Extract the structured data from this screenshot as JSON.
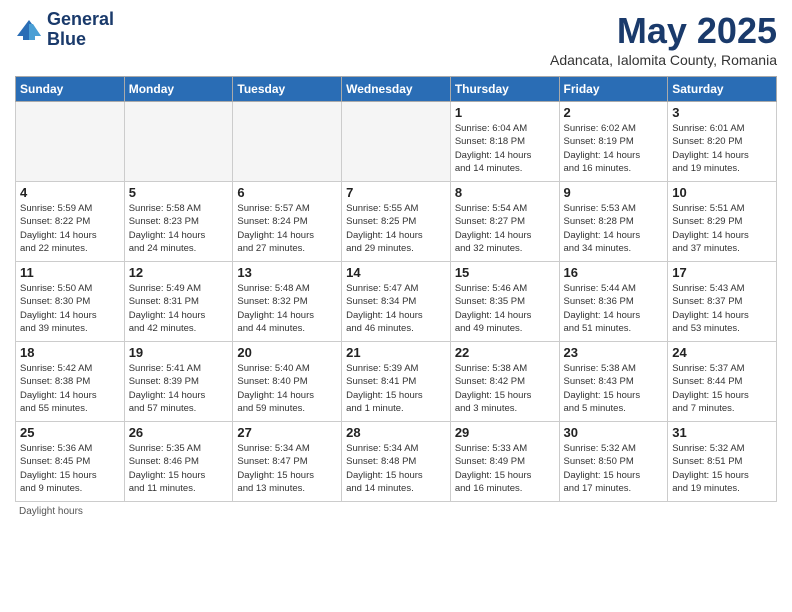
{
  "header": {
    "logo_line1": "General",
    "logo_line2": "Blue",
    "title": "May 2025",
    "subtitle": "Adancata, Ialomita County, Romania"
  },
  "weekdays": [
    "Sunday",
    "Monday",
    "Tuesday",
    "Wednesday",
    "Thursday",
    "Friday",
    "Saturday"
  ],
  "footnote": "Daylight hours",
  "weeks": [
    [
      {
        "day": "",
        "info": ""
      },
      {
        "day": "",
        "info": ""
      },
      {
        "day": "",
        "info": ""
      },
      {
        "day": "",
        "info": ""
      },
      {
        "day": "1",
        "info": "Sunrise: 6:04 AM\nSunset: 8:18 PM\nDaylight: 14 hours\nand 14 minutes."
      },
      {
        "day": "2",
        "info": "Sunrise: 6:02 AM\nSunset: 8:19 PM\nDaylight: 14 hours\nand 16 minutes."
      },
      {
        "day": "3",
        "info": "Sunrise: 6:01 AM\nSunset: 8:20 PM\nDaylight: 14 hours\nand 19 minutes."
      }
    ],
    [
      {
        "day": "4",
        "info": "Sunrise: 5:59 AM\nSunset: 8:22 PM\nDaylight: 14 hours\nand 22 minutes."
      },
      {
        "day": "5",
        "info": "Sunrise: 5:58 AM\nSunset: 8:23 PM\nDaylight: 14 hours\nand 24 minutes."
      },
      {
        "day": "6",
        "info": "Sunrise: 5:57 AM\nSunset: 8:24 PM\nDaylight: 14 hours\nand 27 minutes."
      },
      {
        "day": "7",
        "info": "Sunrise: 5:55 AM\nSunset: 8:25 PM\nDaylight: 14 hours\nand 29 minutes."
      },
      {
        "day": "8",
        "info": "Sunrise: 5:54 AM\nSunset: 8:27 PM\nDaylight: 14 hours\nand 32 minutes."
      },
      {
        "day": "9",
        "info": "Sunrise: 5:53 AM\nSunset: 8:28 PM\nDaylight: 14 hours\nand 34 minutes."
      },
      {
        "day": "10",
        "info": "Sunrise: 5:51 AM\nSunset: 8:29 PM\nDaylight: 14 hours\nand 37 minutes."
      }
    ],
    [
      {
        "day": "11",
        "info": "Sunrise: 5:50 AM\nSunset: 8:30 PM\nDaylight: 14 hours\nand 39 minutes."
      },
      {
        "day": "12",
        "info": "Sunrise: 5:49 AM\nSunset: 8:31 PM\nDaylight: 14 hours\nand 42 minutes."
      },
      {
        "day": "13",
        "info": "Sunrise: 5:48 AM\nSunset: 8:32 PM\nDaylight: 14 hours\nand 44 minutes."
      },
      {
        "day": "14",
        "info": "Sunrise: 5:47 AM\nSunset: 8:34 PM\nDaylight: 14 hours\nand 46 minutes."
      },
      {
        "day": "15",
        "info": "Sunrise: 5:46 AM\nSunset: 8:35 PM\nDaylight: 14 hours\nand 49 minutes."
      },
      {
        "day": "16",
        "info": "Sunrise: 5:44 AM\nSunset: 8:36 PM\nDaylight: 14 hours\nand 51 minutes."
      },
      {
        "day": "17",
        "info": "Sunrise: 5:43 AM\nSunset: 8:37 PM\nDaylight: 14 hours\nand 53 minutes."
      }
    ],
    [
      {
        "day": "18",
        "info": "Sunrise: 5:42 AM\nSunset: 8:38 PM\nDaylight: 14 hours\nand 55 minutes."
      },
      {
        "day": "19",
        "info": "Sunrise: 5:41 AM\nSunset: 8:39 PM\nDaylight: 14 hours\nand 57 minutes."
      },
      {
        "day": "20",
        "info": "Sunrise: 5:40 AM\nSunset: 8:40 PM\nDaylight: 14 hours\nand 59 minutes."
      },
      {
        "day": "21",
        "info": "Sunrise: 5:39 AM\nSunset: 8:41 PM\nDaylight: 15 hours\nand 1 minute."
      },
      {
        "day": "22",
        "info": "Sunrise: 5:38 AM\nSunset: 8:42 PM\nDaylight: 15 hours\nand 3 minutes."
      },
      {
        "day": "23",
        "info": "Sunrise: 5:38 AM\nSunset: 8:43 PM\nDaylight: 15 hours\nand 5 minutes."
      },
      {
        "day": "24",
        "info": "Sunrise: 5:37 AM\nSunset: 8:44 PM\nDaylight: 15 hours\nand 7 minutes."
      }
    ],
    [
      {
        "day": "25",
        "info": "Sunrise: 5:36 AM\nSunset: 8:45 PM\nDaylight: 15 hours\nand 9 minutes."
      },
      {
        "day": "26",
        "info": "Sunrise: 5:35 AM\nSunset: 8:46 PM\nDaylight: 15 hours\nand 11 minutes."
      },
      {
        "day": "27",
        "info": "Sunrise: 5:34 AM\nSunset: 8:47 PM\nDaylight: 15 hours\nand 13 minutes."
      },
      {
        "day": "28",
        "info": "Sunrise: 5:34 AM\nSunset: 8:48 PM\nDaylight: 15 hours\nand 14 minutes."
      },
      {
        "day": "29",
        "info": "Sunrise: 5:33 AM\nSunset: 8:49 PM\nDaylight: 15 hours\nand 16 minutes."
      },
      {
        "day": "30",
        "info": "Sunrise: 5:32 AM\nSunset: 8:50 PM\nDaylight: 15 hours\nand 17 minutes."
      },
      {
        "day": "31",
        "info": "Sunrise: 5:32 AM\nSunset: 8:51 PM\nDaylight: 15 hours\nand 19 minutes."
      }
    ]
  ]
}
